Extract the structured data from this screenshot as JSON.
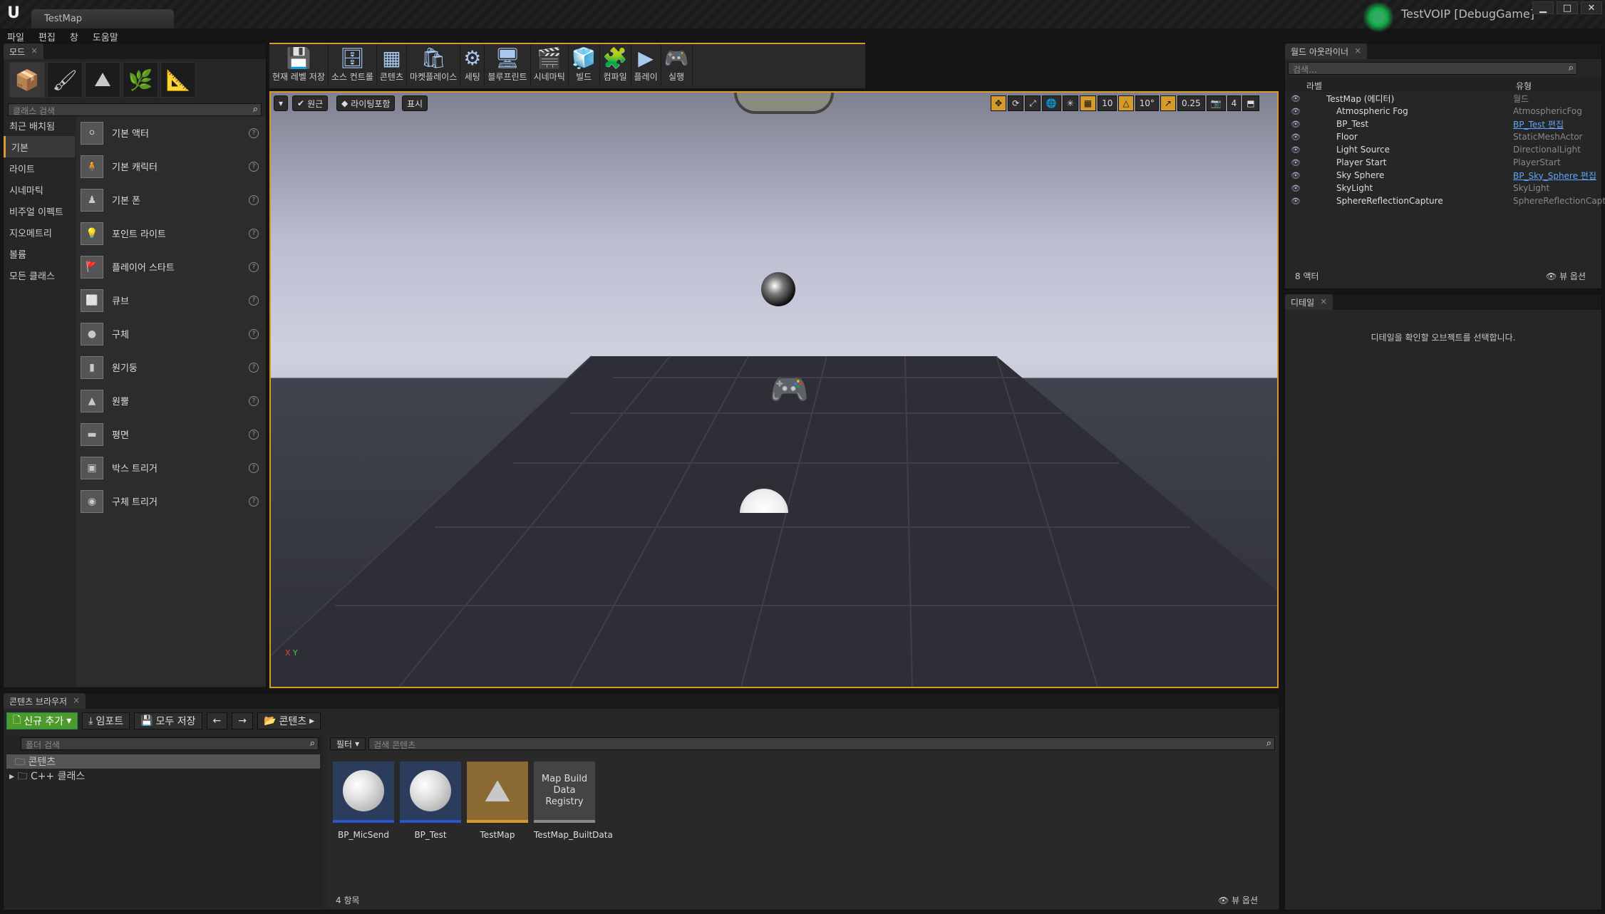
{
  "window": {
    "map_tab": "TestMap",
    "project_title": "TestVOIP [DebugGame]",
    "win_min": "▁",
    "win_max": "□",
    "win_close": "✕"
  },
  "menu": [
    "파일",
    "편집",
    "창",
    "도움말"
  ],
  "modes": {
    "tab": "모드",
    "search_placeholder": "클래스 검색",
    "categories": [
      "최근 배치됨",
      "기본",
      "라이트",
      "시네마틱",
      "비주얼 이펙트",
      "지오메트리",
      "볼륨",
      "모든 클래스"
    ],
    "items": [
      "기본 액터",
      "기본 캐릭터",
      "기본 폰",
      "포인트 라이트",
      "플레이어 스타트",
      "큐브",
      "구체",
      "원기둥",
      "원뿔",
      "평면",
      "박스 트리거",
      "구체 트리거"
    ],
    "help": "?"
  },
  "toolbar": [
    "현재 레벨 저장",
    "소스 컨트롤",
    "콘텐츠",
    "마켓플레이스",
    "세팅",
    "블루프린트",
    "시네마틱",
    "빌드",
    "컴파일",
    "플레이",
    "실행"
  ],
  "viewport": {
    "perspective": "원근",
    "lit": "라이팅포함",
    "show": "표시",
    "grid": "10",
    "rot": "10°",
    "scale": "0.25",
    "speed": "4",
    "axis_x": "X",
    "axis_y": "Y"
  },
  "outliner": {
    "tab": "월드 아웃라이너",
    "search_placeholder": "검색...",
    "col_label": "라벨",
    "col_type": "유형",
    "rows": [
      {
        "name": "TestMap (에디터)",
        "type": "월드",
        "link": false
      },
      {
        "name": "Atmospheric Fog",
        "type": "AtmosphericFog",
        "link": false
      },
      {
        "name": "BP_Test",
        "type": "BP_Test 편집",
        "link": true
      },
      {
        "name": "Floor",
        "type": "StaticMeshActor",
        "link": false
      },
      {
        "name": "Light Source",
        "type": "DirectionalLight",
        "link": false
      },
      {
        "name": "Player Start",
        "type": "PlayerStart",
        "link": false
      },
      {
        "name": "Sky Sphere",
        "type": "BP_Sky_Sphere 편집",
        "link": true
      },
      {
        "name": "SkyLight",
        "type": "SkyLight",
        "link": false
      },
      {
        "name": "SphereReflectionCapture",
        "type": "SphereReflectionCapt",
        "link": false
      }
    ],
    "count": "8 액터",
    "view_options": "뷰 옵션"
  },
  "details": {
    "tab": "디테일",
    "empty": "디테일을 확인할 오브젝트를 선택합니다."
  },
  "content_browser": {
    "tab": "콘텐츠 브라우저",
    "add_new": "신규 추가",
    "import": "임포트",
    "save_all": "모두 저장",
    "path": "콘텐츠",
    "folder_search": "폴더 검색",
    "filter": "필터",
    "search_placeholder": "검색 콘텐츠",
    "folders": [
      "콘텐츠",
      "C++ 클래스"
    ],
    "assets": [
      {
        "name": "BP_MicSend",
        "thumb": ""
      },
      {
        "name": "BP_Test",
        "thumb": ""
      },
      {
        "name": "TestMap",
        "thumb": ""
      },
      {
        "name": "TestMap_BuiltData",
        "thumb": "Map Build Data Registry"
      }
    ],
    "count": "4 항목",
    "view_options": "뷰 옵션"
  }
}
